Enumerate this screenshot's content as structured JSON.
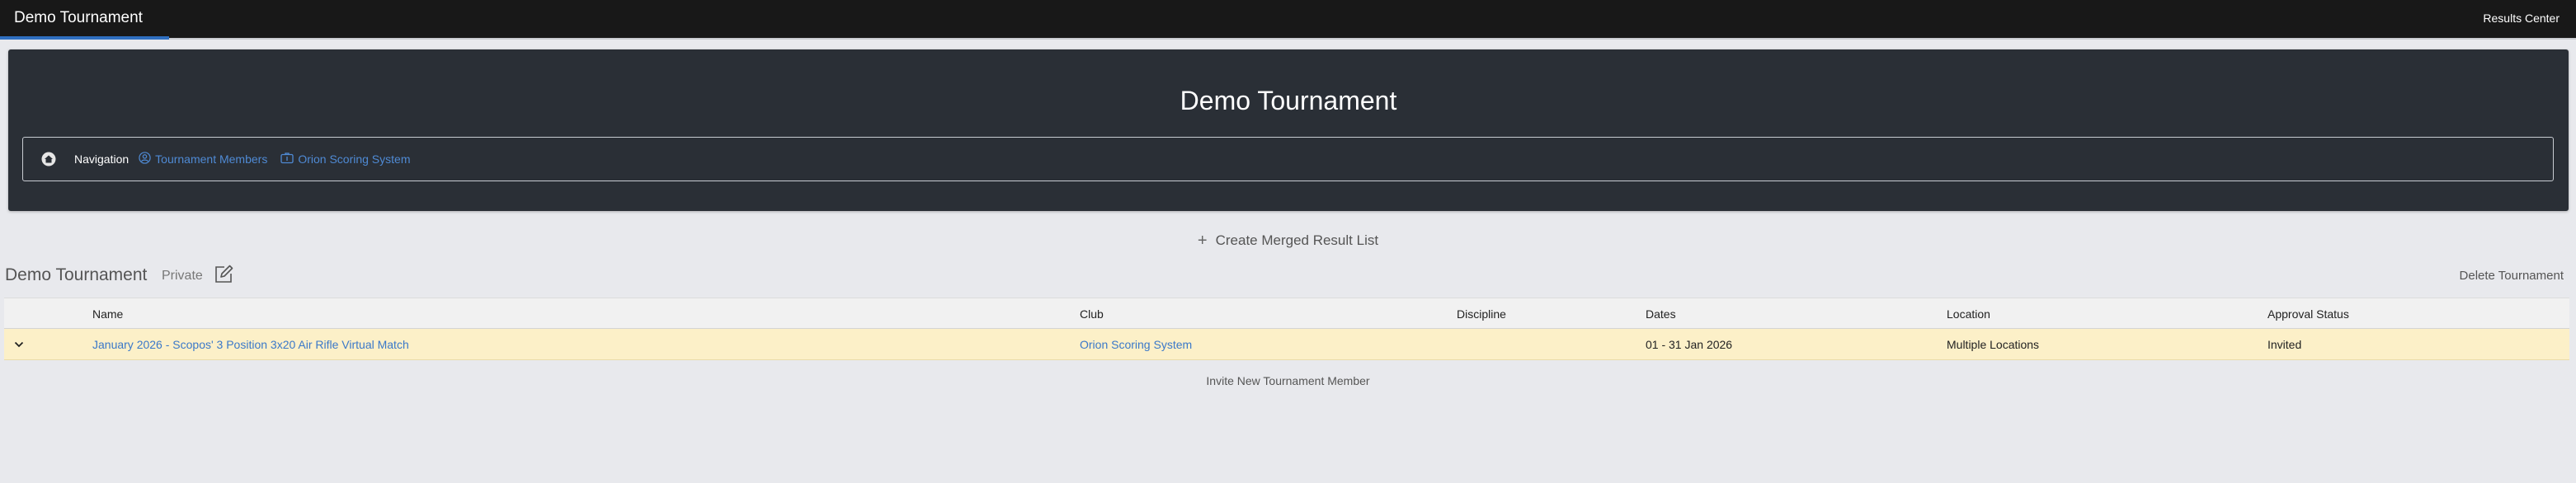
{
  "topbar": {
    "title": "Demo Tournament",
    "right_link": "Results Center"
  },
  "hero": {
    "title": "Demo Tournament",
    "nav": {
      "label": "Navigation",
      "links": [
        {
          "label": "Tournament Members",
          "icon": "user-circle-icon"
        },
        {
          "label": "Orion Scoring System",
          "icon": "id-card-icon"
        }
      ]
    }
  },
  "actions": {
    "create_merged": "Create Merged Result List",
    "delete_tournament": "Delete Tournament",
    "invite_member": "Invite New Tournament Member"
  },
  "tournament": {
    "name": "Demo Tournament",
    "visibility": "Private"
  },
  "table": {
    "headers": [
      "Name",
      "Club",
      "Discipline",
      "Dates",
      "Location",
      "Approval Status"
    ],
    "rows": [
      {
        "name": "January 2026 - Scopos' 3 Position 3x20 Air Rifle Virtual Match",
        "club": "Orion Scoring System",
        "discipline": "",
        "dates": "01 - 31 Jan 2026",
        "location": "Multiple Locations",
        "approval_status": "Invited"
      }
    ]
  },
  "colors": {
    "topbar_bg": "#181818",
    "accent": "#2f6fc0",
    "hero_bg": "#2a2f36",
    "link": "#3a78c9",
    "row_highlight": "#fcf0c8",
    "page_bg": "#e8e9ed"
  }
}
